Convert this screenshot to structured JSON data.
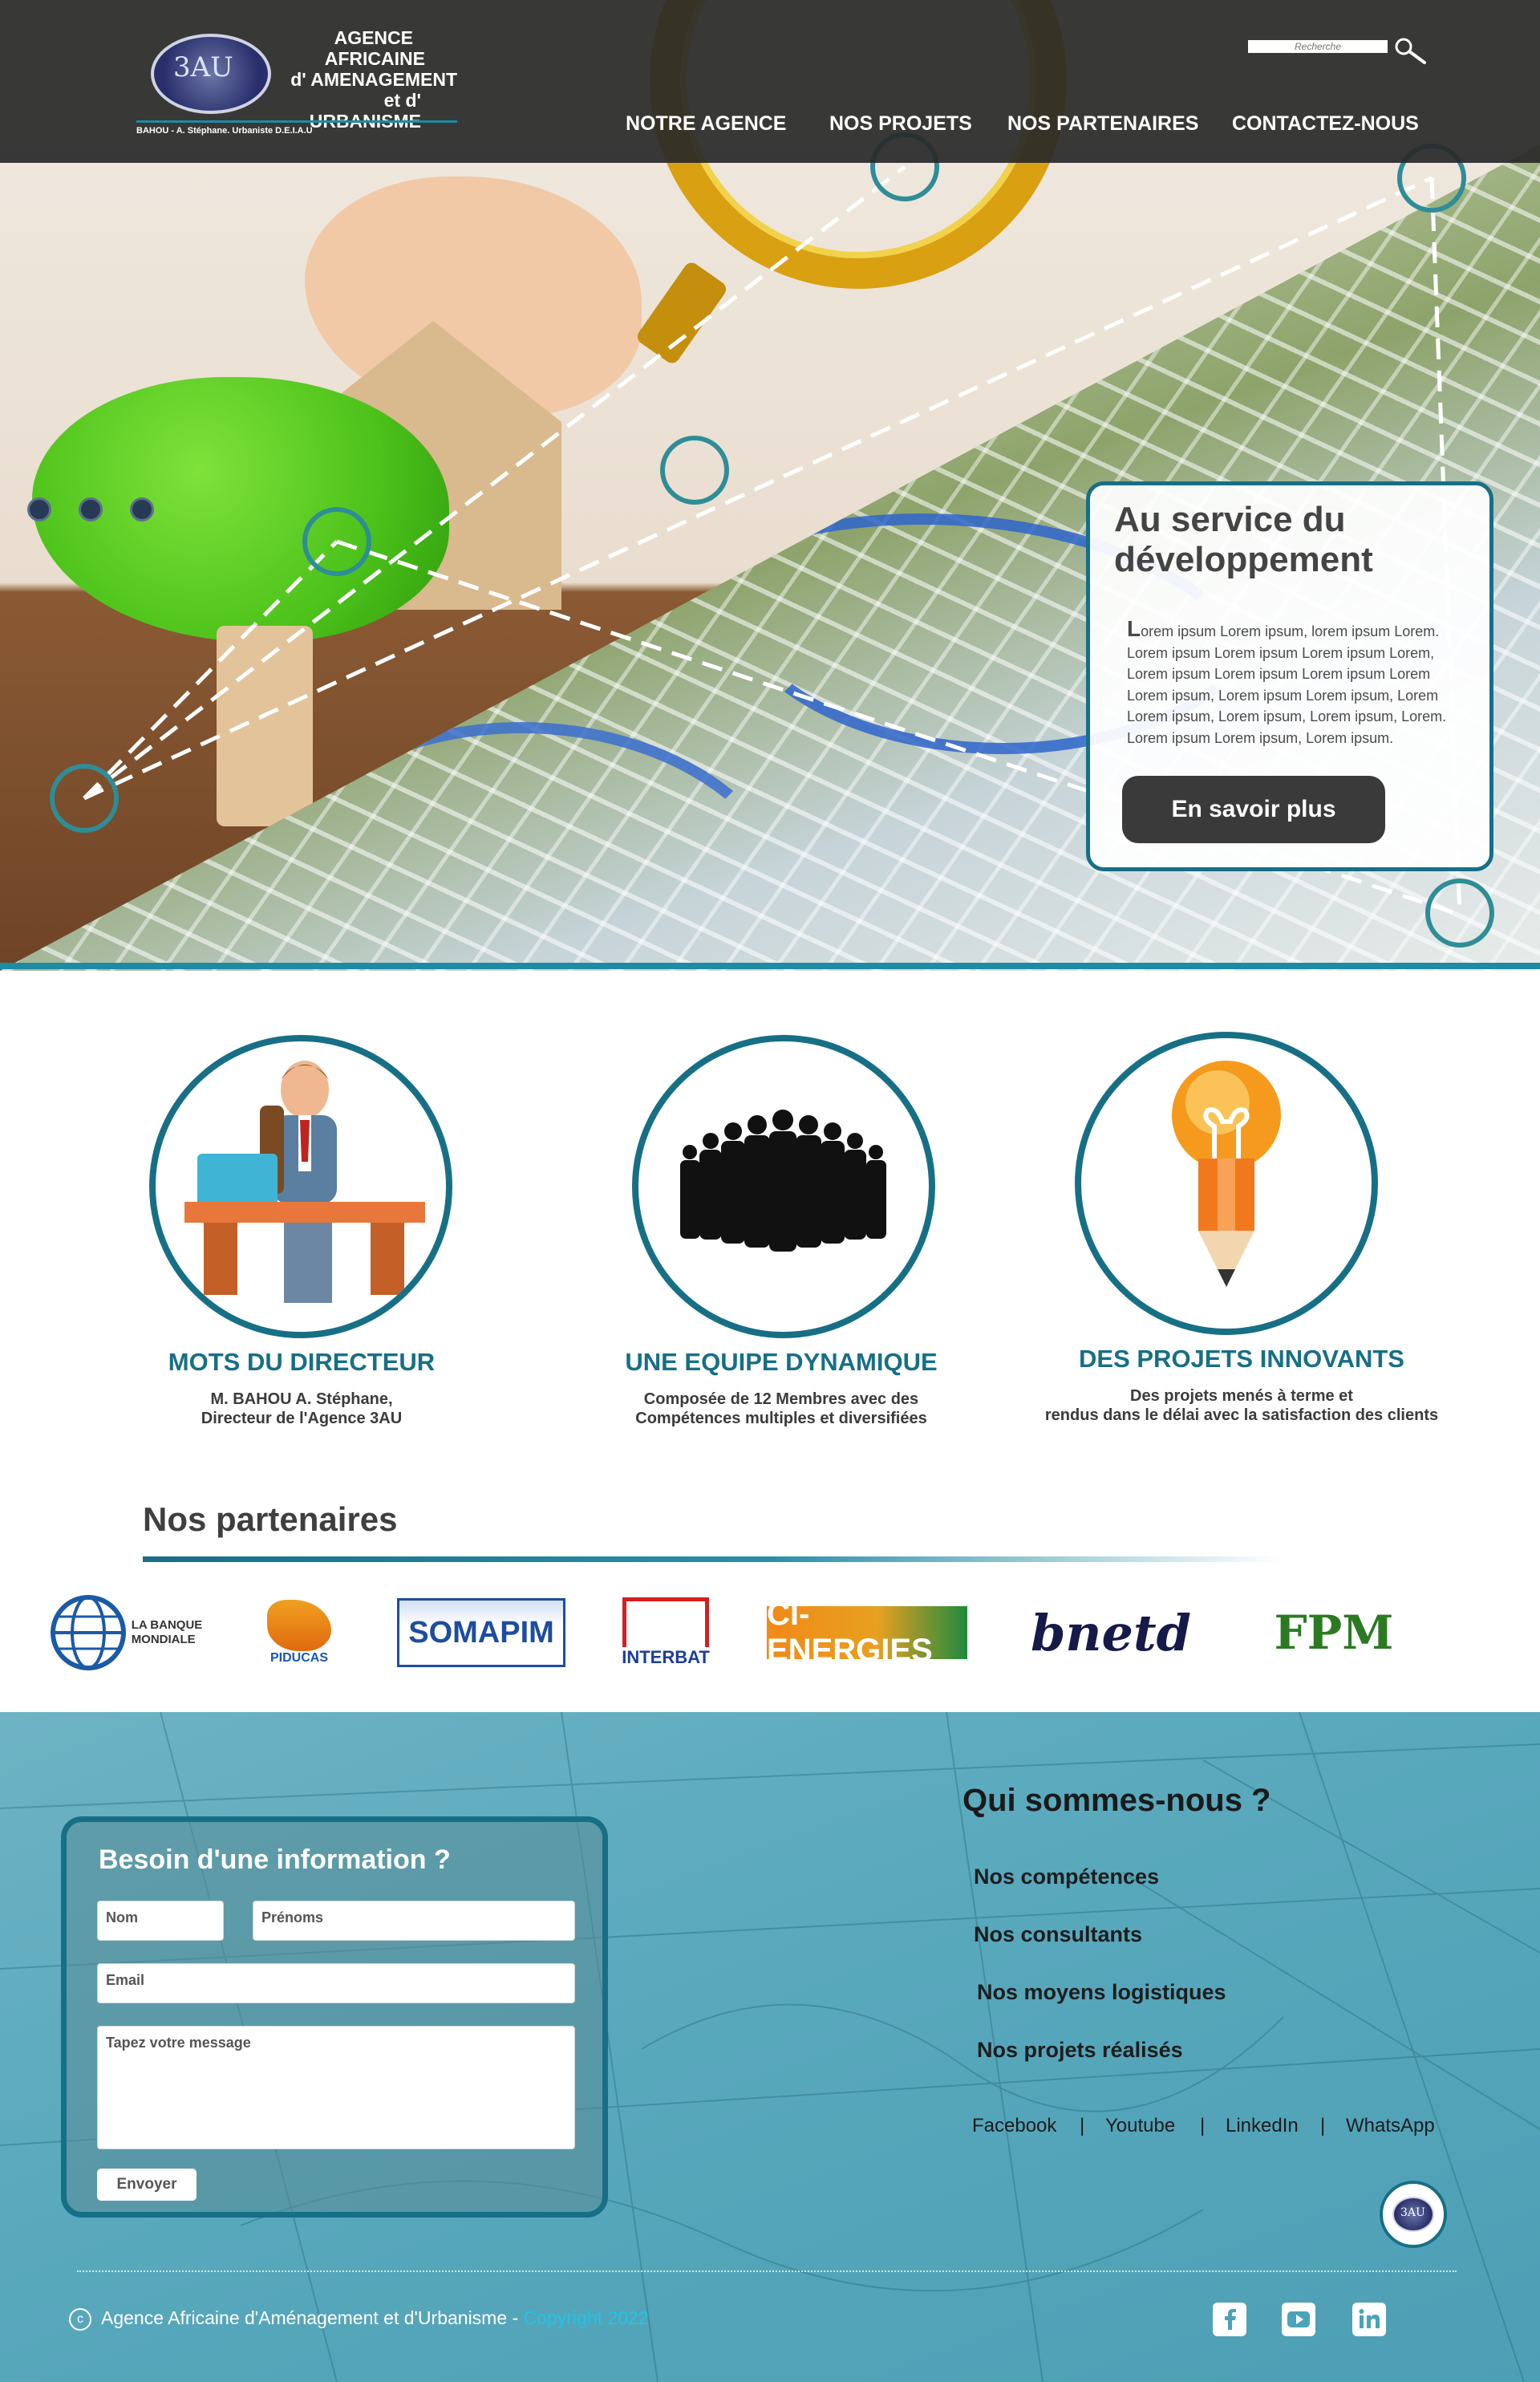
{
  "header": {
    "logo": {
      "mark": "3AU",
      "lines": [
        "AGENCE",
        "AFRICAINE",
        "d' AMENAGEMENT",
        "et d' URBANISME"
      ],
      "subtitle": "BAHOU - A. Stéphane. Urbaniste D.E.I.A.U"
    },
    "search": {
      "placeholder": "Recherche",
      "icon": "magnifier-icon"
    },
    "nav": [
      "NOTRE AGENCE",
      "NOS PROJETS",
      "NOS PARTENAIRES",
      "CONTACTEZ-NOUS"
    ]
  },
  "hero": {
    "card_title": "Au service du développement",
    "card_text": "Lorem ipsum Lorem ipsum, lorem ipsum Lorem. Lorem ipsum Lorem ipsum Lorem ipsum Lorem, Lorem ipsum Lorem ipsum Lorem ipsum Lorem Lorem ipsum, Lorem ipsum Lorem ipsum, Lorem Lorem ipsum, Lorem ipsum, Lorem ipsum, Lorem. Lorem ipsum Lorem ipsum, Lorem ipsum.",
    "button_label": "En savoir plus",
    "slider_dot_count": 3,
    "accent_color": "#176f86"
  },
  "features": [
    {
      "title": "MOTS DU DIRECTEUR",
      "desc": "M. BAHOU A. Stéphane,\nDirecteur de l'Agence 3AU",
      "icon": "director-desk-icon"
    },
    {
      "title": "UNE EQUIPE DYNAMIQUE",
      "desc": "Composée de 12 Membres avec des\nCompétences multiples et diversifiées",
      "icon": "team-silhouette-icon"
    },
    {
      "title": "DES PROJETS INNOVANTS",
      "desc": "Des projets menés à terme et\nrendus dans le délai avec la satisfaction des clients",
      "icon": "lightbulb-pencil-icon"
    }
  ],
  "partners": {
    "title": "Nos partenaires",
    "logos": [
      {
        "name": "banque-mondiale",
        "label": "LA BANQUE\nMONDIALE"
      },
      {
        "name": "piducas",
        "label": "PIDUCAS"
      },
      {
        "name": "somapim",
        "label": "SOMAPIM"
      },
      {
        "name": "interbat",
        "label": "INTERBAT"
      },
      {
        "name": "ci-energies",
        "label": "CI-ENERGIES"
      },
      {
        "name": "bnetd",
        "label": "bnetd"
      },
      {
        "name": "fpm",
        "label": "FPM"
      }
    ]
  },
  "contact_form": {
    "title": "Besoin d'une information ?",
    "nom_placeholder": "Nom",
    "prenoms_placeholder": "Prénoms",
    "email_placeholder": "Email",
    "message_placeholder": "Tapez votre message",
    "send_label": "Envoyer"
  },
  "about": {
    "title": "Qui sommes-nous ?",
    "links": [
      "Nos compétences",
      "Nos consultants",
      "Nos moyens logistiques",
      "Nos projets réalisés"
    ],
    "social_links": [
      "Facebook",
      "Youtube",
      "LinkedIn",
      "WhatsApp"
    ],
    "separator": "|"
  },
  "footer": {
    "copyright_symbol": "c",
    "copyright_text": "Agence Africaine d'Aménagement et d'Urbanisme",
    "copyright_dash": "-",
    "copyright_year": "Copyright 2022",
    "social_icons": [
      "facebook-icon",
      "youtube-icon",
      "linkedin-icon"
    ],
    "year_color": "#1ec7e6"
  }
}
